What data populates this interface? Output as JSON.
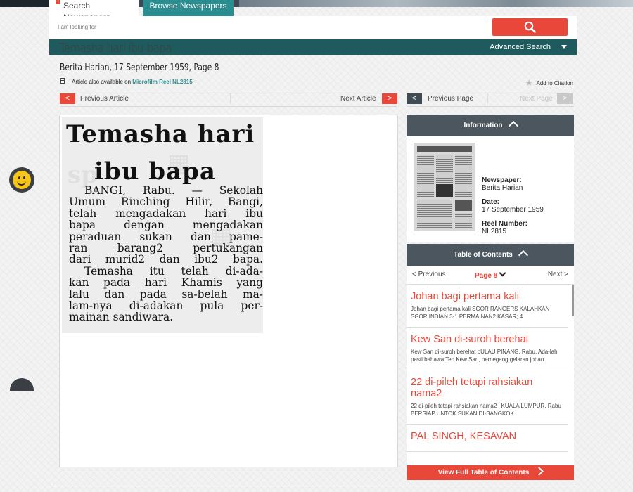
{
  "search": {
    "tab_search": "Search Newspapers",
    "tab_browse": "Browse Newspapers",
    "badge": "!",
    "placeholder": "I am looking for",
    "advanced_label": "Advanced Search"
  },
  "article": {
    "title": "Temasha hari ibu bapa",
    "subtitle": "Berita Harian, 17 September 1959, Page 8",
    "availability_prefix": "Article also available on ",
    "availability_link": "Microfilm Reel NL2815",
    "citation": "Add to Citation",
    "prev_article": "Previous Article",
    "next_article": "Next Article",
    "prev_page": "Previous Page",
    "next_page": "Next Page"
  },
  "clipping": {
    "headline_1": "Temasha hari",
    "headline_2": "ibu bapa",
    "lines": [
      "BANGI, Rabu. — Sekolah",
      "Umum Rinching Hilir, Bangi,",
      "telah mengadakan hari ibu",
      "bapa dengan mengadakan",
      "peraduan sukan dan pame-",
      "ran barang2 pertukangan",
      "dari murid2 dan ibu2 bapa.",
      "Temasha itu telah di-ada-",
      "kan pada hari Khamis yang",
      "lalu dan pada sa-belah ma-",
      "lam-nya di-adakan pula per-",
      "mainan sandiwara."
    ]
  },
  "information": {
    "header": "Information",
    "newspaper_label": "Newspaper:",
    "newspaper_value": "Berita Harian",
    "date_label": "Date:",
    "date_value": "17 September 1959",
    "reel_label": "Reel Number:",
    "reel_value": "NL2815"
  },
  "toc": {
    "header": "Table of Contents",
    "prev": "< Previous",
    "page": "Page 8",
    "next": "Next >",
    "items": [
      {
        "title": "Johan bagi pertama kali",
        "snippet": "Johan bagi pertama kali SGOR RANGERS KALAHKAN SGOR INDIAN 3-1 PERMAINAN2 KASAR; 4"
      },
      {
        "title": "Kew San di-suroh berehat",
        "snippet": "Kew San di-suroh berehat pULAU PINANG, Rabu. Ada-lah pasti bahawa Teh Kew San, pemegang gelaran johan"
      },
      {
        "title": "22 di-pileh tetapi rahsiakan nama2",
        "snippet": "22 di-pileh tetapi rahsiakan nama2 i KUALA LUMPUR, Rabu BERSIAP UNTOK SUKAN DI-BANGKOK"
      },
      {
        "title": "PAL SINGH, KESAVAN",
        "snippet": ""
      }
    ],
    "footer": "View Full Table of Contents"
  },
  "colors": {
    "accent_red": "#e8473a",
    "teal": "#2a8d8f",
    "dark_teal": "#1f5b5e",
    "panel_header": "#4b565e"
  },
  "icons": [
    "search-icon",
    "caret-down-icon",
    "document-icon",
    "star-icon",
    "chevron-left-icon",
    "chevron-right-icon",
    "chevron-up-icon",
    "smiley-icon",
    "chat-icon"
  ]
}
